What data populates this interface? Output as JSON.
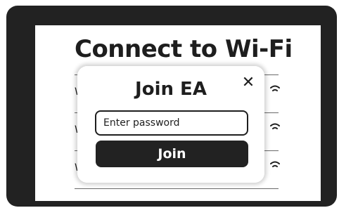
{
  "screen": {
    "title": "Connect to Wi-Fi",
    "networks": [
      {
        "initial": "W",
        "signal_icon": "wifi-icon"
      },
      {
        "initial": "W",
        "signal_icon": "wifi-icon"
      },
      {
        "initial": "W",
        "signal_icon": "wifi-icon"
      }
    ]
  },
  "modal": {
    "title": "Join EA",
    "close_icon": "close-icon",
    "close_glyph": "✕",
    "password_placeholder": "Enter password",
    "password_value": "",
    "join_label": "Join"
  },
  "colors": {
    "frame": "#222222",
    "screen_background": "#ffffff",
    "text": "#1e1e1e",
    "button": "#222222",
    "button_text": "#ffffff"
  }
}
